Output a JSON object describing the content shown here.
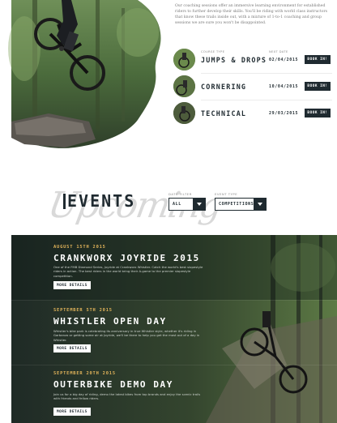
{
  "intro": {
    "text": "Our coaching sessions offer an immersive learning environment for established riders to further develop their skills. You'll be riding with world class instructors that know these trails inside out, with a mixture of 1-to-1 coaching and group sessions we are sure you won't be disappointed."
  },
  "sessions": {
    "col_label_left": "COURSE TYPE",
    "col_label_right": "NEXT DATE",
    "items": [
      {
        "title": "JUMPS & DROPS",
        "date": "02/04/2015",
        "button": "BOOK IN!"
      },
      {
        "title": "CORNERING",
        "date": "10/04/2015",
        "button": "BOOK IN!"
      },
      {
        "title": "TECHNICAL",
        "date": "29/03/2015",
        "button": "BOOK IN!"
      }
    ]
  },
  "events": {
    "script_word": "Upcoming",
    "heading": "EVENTS",
    "date_filter_label": "DATE FILTER",
    "date_filter_value": "ALL",
    "type_filter_label": "EVENT TYPE",
    "type_filter_value": "COMPETITIONS",
    "items": [
      {
        "date": "AUGUST 15TH 2015",
        "title": "CRANKWORX JOYRIDE 2015",
        "desc": "One of the FMB Diamond Series, Joyride at Crankworx Whistler. Catch the world's best slopestyle riders in action. The best riders in the world bring their A-game to the premier slopestyle competition.",
        "button": "MORE DETAILS"
      },
      {
        "date": "SEPTEMBER 5TH 2015",
        "title": "WHISTLER OPEN DAY",
        "desc": "Whistler's bike park is celebrating its anniversary in true Whistler style, whether it's riding in Garbanzo or getting some air at Joyride, we'll be there to help you get the most out of a day in Whistler.",
        "button": "MORE DETAILS"
      },
      {
        "date": "SEPTEMBER 20TH 2015",
        "title": "OUTERBIKE DEMO DAY",
        "desc": "Join us for a big day of riding, demo the latest bikes from top brands and enjoy the scenic trails with friends and fellow riders.",
        "button": "MORE DETAILS"
      }
    ]
  },
  "colors": {
    "dark": "#1f2a30",
    "accent": "#e2b45a",
    "page_bg": "#ffffff"
  }
}
